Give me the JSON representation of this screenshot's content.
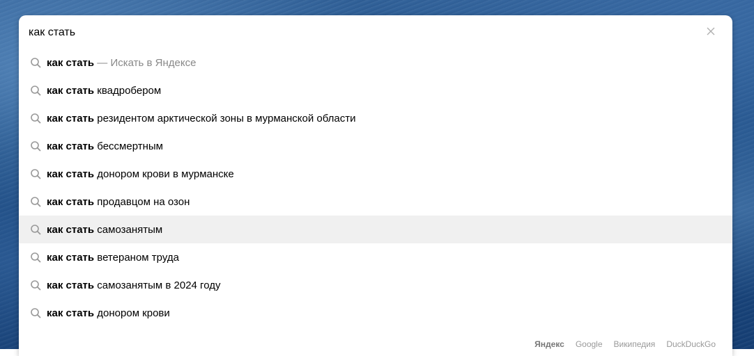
{
  "search": {
    "value": "как стать"
  },
  "suggestions": [
    {
      "bold": "как стать",
      "rest": "",
      "hint": " — Искать в Яндексе"
    },
    {
      "bold": "как стать",
      "rest": " квадробером",
      "hint": ""
    },
    {
      "bold": "как стать",
      "rest": " резидентом арктической зоны в мурманской области",
      "hint": ""
    },
    {
      "bold": "как стать",
      "rest": " бессмертным",
      "hint": ""
    },
    {
      "bold": "как стать",
      "rest": " донором крови в мурманске",
      "hint": ""
    },
    {
      "bold": "как стать",
      "rest": " продавцом на озон",
      "hint": ""
    },
    {
      "bold": "как стать",
      "rest": " самозанятым",
      "hint": ""
    },
    {
      "bold": "как стать",
      "rest": " ветераном труда",
      "hint": ""
    },
    {
      "bold": "как стать",
      "rest": " самозанятым в 2024 году",
      "hint": ""
    },
    {
      "bold": "как стать",
      "rest": " донором крови",
      "hint": ""
    }
  ],
  "highlighted_index": 6,
  "engines": {
    "yandex": "Яндекс",
    "google": "Google",
    "wikipedia": "Википедия",
    "duckduckgo": "DuckDuckGo"
  },
  "icons": {
    "search": "search-icon",
    "clear": "close-icon"
  },
  "colors": {
    "highlight": "#f0f0f0",
    "hint_text": "#888888",
    "engine_text": "#999999"
  }
}
